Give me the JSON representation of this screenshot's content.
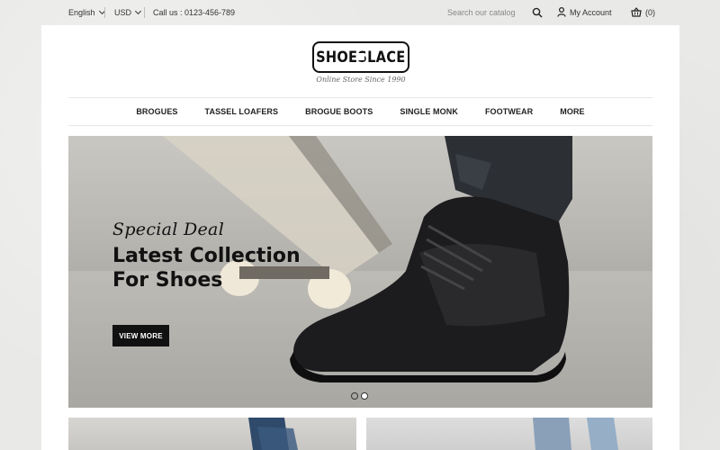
{
  "topbar": {
    "language": "English",
    "currency": "USD",
    "call_us": "Call us : 0123-456-789",
    "search_placeholder": "Search our catalog",
    "account_label": "My Account",
    "cart_count": "(0)"
  },
  "brand": {
    "logo": "SHOESLACE",
    "tagline": "Online Store Since 1990"
  },
  "nav": {
    "items": [
      "BROGUES",
      "TASSEL LOAFERS",
      "BROGUE BOOTS",
      "SINGLE MONK",
      "FOOTWEAR",
      "MORE"
    ]
  },
  "hero": {
    "script_title": "Special Deal",
    "title_line1": "Latest Collection",
    "title_line2": "For Shoes",
    "button_label": "VIEW MORE",
    "slides_total": 2,
    "active_slide": 2
  },
  "colors": {
    "accent": "#111111",
    "panel_bg": "#ffffff",
    "page_bg": "#e9e9e7"
  },
  "icons": {
    "search": "search-icon",
    "account": "user-icon",
    "cart": "basket-icon"
  }
}
